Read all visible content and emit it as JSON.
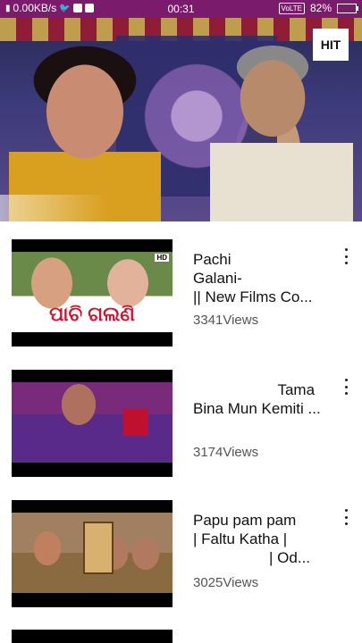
{
  "status_bar": {
    "data_speed": "0.00KB/s",
    "time": "00:31",
    "network": "VoLTE",
    "battery": "82%",
    "battery_level": 0.82,
    "icons": [
      "signal-icon",
      "twitter-icon",
      "youtube-icon",
      "facebook-icon"
    ]
  },
  "hero": {
    "badge": "HIT"
  },
  "videos": [
    {
      "title": "Pachi\nGalani-\n|| New Films Co...",
      "views": "3341Views",
      "thumb_text": "ପାଚି ଗଲଣି",
      "thumb_badge": "HD"
    },
    {
      "title": "                    Tama\nBina Mun Kemiti ...",
      "views": "3174Views"
    },
    {
      "title": "Papu pam pam\n| Faltu Katha |\n                  | Od...",
      "views": "3025Views"
    }
  ],
  "colors": {
    "status_bar": "#7a1c6b",
    "views_text": "#555555"
  }
}
